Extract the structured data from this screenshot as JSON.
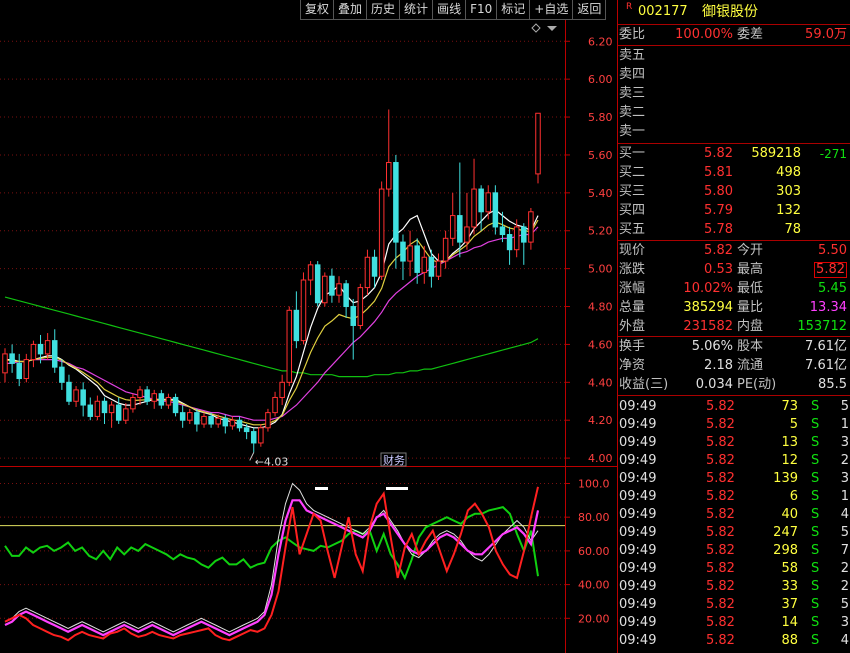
{
  "toolbar": [
    "复权",
    "叠加",
    "历史",
    "统计",
    "画线",
    "F10",
    "标记",
    "+自选",
    "返回"
  ],
  "stock": {
    "badge": "R",
    "code": "002177",
    "name": "御银股份"
  },
  "ratio": {
    "label1": "委比",
    "val1": "100.00%",
    "label2": "委差",
    "val2": "59.0万"
  },
  "asks": [
    {
      "label": "卖五"
    },
    {
      "label": "卖四"
    },
    {
      "label": "卖三"
    },
    {
      "label": "卖二"
    },
    {
      "label": "卖一"
    }
  ],
  "bids": [
    {
      "label": "买一",
      "price": "5.82",
      "vol": "589218",
      "chg": "-271"
    },
    {
      "label": "买二",
      "price": "5.81",
      "vol": "498",
      "chg": ""
    },
    {
      "label": "买三",
      "price": "5.80",
      "vol": "303",
      "chg": ""
    },
    {
      "label": "买四",
      "price": "5.79",
      "vol": "132",
      "chg": ""
    },
    {
      "label": "买五",
      "price": "5.78",
      "vol": "78",
      "chg": ""
    }
  ],
  "quote": [
    {
      "l1": "现价",
      "v1": "5.82",
      "l2": "今开",
      "v2": "5.50"
    },
    {
      "l1": "涨跌",
      "v1": "0.53",
      "l2": "最高",
      "v2": "5.82"
    },
    {
      "l1": "涨幅",
      "v1": "10.02%",
      "l2": "最低",
      "v2": "5.45"
    },
    {
      "l1": "总量",
      "v1": "385294",
      "l2": "量比",
      "v2": "13.34"
    },
    {
      "l1": "外盘",
      "v1": "231582",
      "l2": "内盘",
      "v2": "153712"
    }
  ],
  "stats": [
    {
      "l1": "换手",
      "v1": "5.06%",
      "l2": "股本",
      "v2": "7.61亿"
    },
    {
      "l1": "净资",
      "v1": "2.18",
      "l2": "流通",
      "v2": "7.61亿"
    },
    {
      "l1": "收益(三)",
      "v1": "0.034",
      "l2": "PE(动)",
      "v2": "85.5"
    }
  ],
  "ticks": [
    {
      "t": "09:49",
      "p": "5.82",
      "v": "73",
      "s": "S",
      "n": "5"
    },
    {
      "t": "09:49",
      "p": "5.82",
      "v": "5",
      "s": "S",
      "n": "1"
    },
    {
      "t": "09:49",
      "p": "5.82",
      "v": "13",
      "s": "S",
      "n": "3"
    },
    {
      "t": "09:49",
      "p": "5.82",
      "v": "12",
      "s": "S",
      "n": "2"
    },
    {
      "t": "09:49",
      "p": "5.82",
      "v": "139",
      "s": "S",
      "n": "3"
    },
    {
      "t": "09:49",
      "p": "5.82",
      "v": "6",
      "s": "S",
      "n": "1"
    },
    {
      "t": "09:49",
      "p": "5.82",
      "v": "40",
      "s": "S",
      "n": "4"
    },
    {
      "t": "09:49",
      "p": "5.82",
      "v": "247",
      "s": "S",
      "n": "5"
    },
    {
      "t": "09:49",
      "p": "5.82",
      "v": "298",
      "s": "S",
      "n": "7"
    },
    {
      "t": "09:49",
      "p": "5.82",
      "v": "58",
      "s": "S",
      "n": "2"
    },
    {
      "t": "09:49",
      "p": "5.82",
      "v": "33",
      "s": "S",
      "n": "2"
    },
    {
      "t": "09:49",
      "p": "5.82",
      "v": "37",
      "s": "S",
      "n": "5"
    },
    {
      "t": "09:49",
      "p": "5.82",
      "v": "14",
      "s": "S",
      "n": "3"
    },
    {
      "t": "09:49",
      "p": "5.82",
      "v": "88",
      "s": "S",
      "n": "4"
    }
  ],
  "chart_data": {
    "type": "candlestick",
    "price_axis": [
      "6.20",
      "6.00",
      "5.80",
      "5.60",
      "5.40",
      "5.20",
      "5.00",
      "4.80",
      "4.60",
      "4.40",
      "4.20",
      "4.00"
    ],
    "price_range": [
      3.99,
      6.27
    ],
    "low_marker": "4.03",
    "badge": "财务",
    "candles": [
      [
        4.45,
        4.55,
        4.4,
        4.58
      ],
      [
        4.55,
        4.5,
        4.45,
        4.6
      ],
      [
        4.5,
        4.42,
        4.38,
        4.55
      ],
      [
        4.42,
        4.52,
        4.4,
        4.55
      ],
      [
        4.52,
        4.6,
        4.48,
        4.62
      ],
      [
        4.6,
        4.55,
        4.5,
        4.65
      ],
      [
        4.55,
        4.62,
        4.52,
        4.66
      ],
      [
        4.62,
        4.48,
        4.45,
        4.68
      ],
      [
        4.48,
        4.4,
        4.36,
        4.52
      ],
      [
        4.4,
        4.3,
        4.28,
        4.44
      ],
      [
        4.3,
        4.36,
        4.27,
        4.38
      ],
      [
        4.36,
        4.28,
        4.22,
        4.4
      ],
      [
        4.28,
        4.22,
        4.2,
        4.32
      ],
      [
        4.22,
        4.3,
        4.2,
        4.33
      ],
      [
        4.3,
        4.24,
        4.18,
        4.32
      ],
      [
        4.24,
        4.28,
        4.16,
        4.3
      ],
      [
        4.28,
        4.2,
        4.18,
        4.32
      ],
      [
        4.2,
        4.26,
        4.18,
        4.29
      ],
      [
        4.26,
        4.32,
        4.24,
        4.34
      ],
      [
        4.32,
        4.36,
        4.28,
        4.38
      ],
      [
        4.36,
        4.3,
        4.28,
        4.38
      ],
      [
        4.3,
        4.34,
        4.26,
        4.36
      ],
      [
        4.34,
        4.28,
        4.26,
        4.36
      ],
      [
        4.28,
        4.32,
        4.26,
        4.34
      ],
      [
        4.32,
        4.24,
        4.22,
        4.34
      ],
      [
        4.24,
        4.2,
        4.16,
        4.28
      ],
      [
        4.2,
        4.24,
        4.18,
        4.26
      ],
      [
        4.24,
        4.18,
        4.14,
        4.26
      ],
      [
        4.18,
        4.22,
        4.16,
        4.24
      ],
      [
        4.22,
        4.18,
        4.16,
        4.24
      ],
      [
        4.18,
        4.21,
        4.16,
        4.23
      ],
      [
        4.21,
        4.17,
        4.13,
        4.23
      ],
      [
        4.17,
        4.2,
        4.15,
        4.22
      ],
      [
        4.2,
        4.16,
        4.14,
        4.22
      ],
      [
        4.16,
        4.14,
        4.1,
        4.18
      ],
      [
        4.14,
        4.08,
        4.03,
        4.16
      ],
      [
        4.08,
        4.16,
        4.06,
        4.18
      ],
      [
        4.16,
        4.24,
        4.14,
        4.26
      ],
      [
        4.24,
        4.32,
        4.22,
        4.35
      ],
      [
        4.32,
        4.4,
        4.28,
        4.44
      ],
      [
        4.4,
        4.78,
        4.38,
        4.8
      ],
      [
        4.78,
        4.62,
        4.58,
        4.88
      ],
      [
        4.62,
        4.94,
        4.6,
        4.98
      ],
      [
        4.94,
        5.02,
        4.86,
        5.04
      ],
      [
        5.02,
        4.82,
        4.8,
        5.04
      ],
      [
        4.82,
        4.96,
        4.8,
        4.98
      ],
      [
        4.96,
        4.86,
        4.82,
        5.0
      ],
      [
        4.86,
        4.92,
        4.82,
        4.96
      ],
      [
        4.92,
        4.8,
        4.74,
        4.94
      ],
      [
        4.8,
        4.7,
        4.52,
        4.84
      ],
      [
        4.7,
        4.9,
        4.68,
        4.92
      ],
      [
        4.9,
        5.06,
        4.86,
        5.1
      ],
      [
        5.06,
        4.96,
        4.9,
        5.1
      ],
      [
        4.96,
        5.42,
        4.94,
        5.46
      ],
      [
        5.42,
        5.56,
        5.38,
        5.84
      ],
      [
        5.56,
        5.14,
        5.0,
        5.6
      ],
      [
        5.14,
        5.04,
        4.94,
        5.18
      ],
      [
        5.04,
        5.12,
        4.96,
        5.2
      ],
      [
        5.12,
        4.98,
        4.92,
        5.16
      ],
      [
        4.98,
        5.06,
        4.92,
        5.12
      ],
      [
        5.06,
        4.96,
        4.9,
        5.1
      ],
      [
        4.96,
        5.04,
        4.94,
        5.08
      ],
      [
        5.04,
        5.16,
        5.0,
        5.2
      ],
      [
        5.16,
        5.28,
        5.12,
        5.4
      ],
      [
        5.28,
        5.14,
        5.06,
        5.56
      ],
      [
        5.14,
        5.22,
        5.1,
        5.4
      ],
      [
        5.22,
        5.42,
        5.18,
        5.58
      ],
      [
        5.42,
        5.3,
        5.2,
        5.44
      ],
      [
        5.3,
        5.4,
        5.26,
        5.44
      ],
      [
        5.4,
        5.22,
        5.18,
        5.44
      ],
      [
        5.22,
        5.18,
        5.14,
        5.3
      ],
      [
        5.18,
        5.1,
        5.02,
        5.22
      ],
      [
        5.1,
        5.22,
        5.06,
        5.26
      ],
      [
        5.22,
        5.14,
        5.02,
        5.24
      ],
      [
        5.14,
        5.3,
        5.1,
        5.32
      ],
      [
        5.5,
        5.82,
        5.45,
        5.82
      ]
    ],
    "ma_short": [
      4.52,
      4.52,
      4.51,
      4.51,
      4.52,
      4.53,
      4.54,
      4.54,
      4.52,
      4.49,
      4.47,
      4.44,
      4.41,
      4.38,
      4.33,
      4.31,
      4.29,
      4.28,
      4.28,
      4.29,
      4.3,
      4.31,
      4.31,
      4.31,
      4.31,
      4.29,
      4.27,
      4.25,
      4.24,
      4.23,
      4.21,
      4.2,
      4.19,
      4.18,
      4.17,
      4.16,
      4.16,
      4.17,
      4.19,
      4.23,
      4.34,
      4.43,
      4.56,
      4.69,
      4.79,
      4.86,
      4.88,
      4.91,
      4.86,
      4.82,
      4.83,
      4.86,
      4.9,
      4.98,
      5.13,
      5.18,
      5.21,
      5.26,
      5.28,
      5.18,
      5.08,
      5.04,
      5.04,
      5.08,
      5.11,
      5.15,
      5.21,
      5.25,
      5.29,
      5.31,
      5.28,
      5.25,
      5.23,
      5.22,
      5.2,
      5.28
    ],
    "ma_mid": [
      4.5,
      4.5,
      4.51,
      4.51,
      4.52,
      4.52,
      4.52,
      4.52,
      4.51,
      4.5,
      4.48,
      4.47,
      4.45,
      4.43,
      4.41,
      4.39,
      4.37,
      4.35,
      4.34,
      4.33,
      4.32,
      4.31,
      4.3,
      4.3,
      4.29,
      4.28,
      4.27,
      4.26,
      4.25,
      4.24,
      4.24,
      4.23,
      4.22,
      4.22,
      4.21,
      4.2,
      4.2,
      4.2,
      4.21,
      4.22,
      4.25,
      4.28,
      4.32,
      4.36,
      4.4,
      4.45,
      4.49,
      4.53,
      4.57,
      4.61,
      4.64,
      4.68,
      4.72,
      4.77,
      4.83,
      4.87,
      4.9,
      4.93,
      4.96,
      4.98,
      5.0,
      5.02,
      5.04,
      5.06,
      5.08,
      5.09,
      5.11,
      5.12,
      5.14,
      5.15,
      5.16,
      5.16,
      5.17,
      5.18,
      5.18,
      5.22
    ],
    "ma_long": [
      4.85,
      4.84,
      4.83,
      4.82,
      4.81,
      4.8,
      4.79,
      4.78,
      4.77,
      4.76,
      4.75,
      4.74,
      4.73,
      4.72,
      4.71,
      4.7,
      4.69,
      4.68,
      4.67,
      4.66,
      4.65,
      4.64,
      4.63,
      4.62,
      4.61,
      4.6,
      4.59,
      4.58,
      4.57,
      4.56,
      4.55,
      4.54,
      4.53,
      4.52,
      4.51,
      4.5,
      4.49,
      4.48,
      4.47,
      4.46,
      4.46,
      4.45,
      4.45,
      4.44,
      4.44,
      4.44,
      4.44,
      4.43,
      4.43,
      4.43,
      4.43,
      4.43,
      4.44,
      4.44,
      4.44,
      4.45,
      4.45,
      4.46,
      4.46,
      4.47,
      4.47,
      4.48,
      4.49,
      4.5,
      4.51,
      4.52,
      4.53,
      4.54,
      4.55,
      4.56,
      4.57,
      4.58,
      4.59,
      4.6,
      4.61,
      4.63
    ],
    "osc_axis": [
      "100.0",
      "80.00",
      "60.00",
      "40.00",
      "20.00"
    ],
    "osc_range": [
      0,
      108
    ],
    "osc_ref": 75,
    "osc_green": [
      63,
      57,
      57,
      62,
      59,
      62,
      63,
      60,
      62,
      65,
      60,
      62,
      57,
      55,
      60,
      55,
      62,
      58,
      62,
      60,
      64,
      62,
      60,
      58,
      55,
      58,
      56,
      55,
      52,
      50,
      54,
      56,
      52,
      52,
      55,
      50,
      52,
      53,
      62,
      66,
      68,
      65,
      62,
      61,
      60,
      63,
      62,
      64,
      66,
      70,
      72,
      70,
      72,
      60,
      70,
      58,
      52,
      44,
      55,
      68,
      74,
      76,
      78,
      80,
      78,
      76,
      80,
      82,
      82,
      84,
      85,
      86,
      82,
      70,
      60,
      72,
      45
    ],
    "osc_red": [
      18,
      20,
      22,
      20,
      16,
      14,
      12,
      10,
      9,
      7,
      10,
      12,
      10,
      9,
      8,
      11,
      12,
      14,
      11,
      9,
      10,
      12,
      10,
      9,
      8,
      10,
      11,
      12,
      13,
      14,
      10,
      8,
      7,
      9,
      11,
      13,
      12,
      14,
      22,
      36,
      62,
      86,
      58,
      70,
      82,
      78,
      60,
      44,
      62,
      80,
      58,
      48,
      74,
      88,
      94,
      68,
      44,
      62,
      70,
      58,
      66,
      72,
      60,
      48,
      58,
      70,
      84,
      88,
      82,
      74,
      60,
      52,
      46,
      44,
      60,
      80,
      98
    ],
    "osc_white": [
      18,
      20,
      24,
      26,
      24,
      22,
      20,
      18,
      16,
      14,
      16,
      18,
      16,
      14,
      12,
      14,
      16,
      18,
      16,
      14,
      16,
      18,
      16,
      14,
      12,
      14,
      16,
      18,
      20,
      18,
      16,
      14,
      12,
      14,
      16,
      18,
      20,
      24,
      40,
      68,
      88,
      100,
      96,
      88,
      84,
      82,
      80,
      78,
      76,
      74,
      72,
      70,
      74,
      80,
      84,
      78,
      72,
      64,
      58,
      56,
      60,
      66,
      70,
      72,
      70,
      66,
      60,
      56,
      54,
      58,
      64,
      70,
      74,
      78,
      74,
      66,
      72
    ],
    "osc_magenta": [
      16,
      18,
      22,
      24,
      22,
      20,
      18,
      16,
      14,
      12,
      14,
      16,
      14,
      12,
      10,
      12,
      14,
      16,
      14,
      12,
      14,
      16,
      14,
      12,
      10,
      12,
      14,
      16,
      18,
      16,
      14,
      12,
      10,
      12,
      14,
      16,
      18,
      22,
      34,
      58,
      78,
      90,
      90,
      84,
      82,
      80,
      78,
      76,
      74,
      72,
      70,
      68,
      72,
      80,
      82,
      76,
      70,
      64,
      60,
      58,
      60,
      64,
      68,
      70,
      68,
      64,
      60,
      58,
      58,
      62,
      66,
      70,
      72,
      74,
      70,
      64,
      84
    ]
  }
}
